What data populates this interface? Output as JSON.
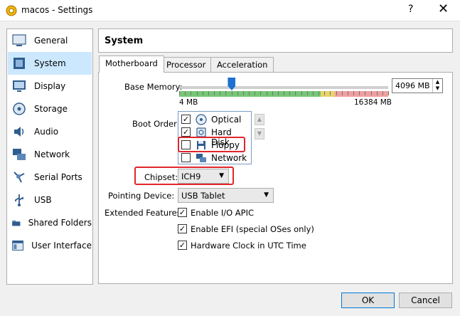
{
  "window": {
    "title": "macos - Settings",
    "help_label": "?",
    "close_label": "✕"
  },
  "sidebar": {
    "items": [
      {
        "label": "General",
        "icon": "general-icon"
      },
      {
        "label": "System",
        "icon": "system-icon",
        "selected": true
      },
      {
        "label": "Display",
        "icon": "display-icon"
      },
      {
        "label": "Storage",
        "icon": "storage-icon"
      },
      {
        "label": "Audio",
        "icon": "audio-icon"
      },
      {
        "label": "Network",
        "icon": "network-icon"
      },
      {
        "label": "Serial Ports",
        "icon": "serial-ports-icon"
      },
      {
        "label": "USB",
        "icon": "usb-icon"
      },
      {
        "label": "Shared Folders",
        "icon": "shared-folders-icon"
      },
      {
        "label": "User Interface",
        "icon": "user-interface-icon"
      }
    ]
  },
  "page": {
    "title": "System"
  },
  "tabs": [
    {
      "label": "Motherboard",
      "active": true
    },
    {
      "label": "Processor"
    },
    {
      "label": "Acceleration"
    }
  ],
  "motherboard": {
    "base_memory_label": "Base Memory:",
    "memory_min_label": "4 MB",
    "memory_max_label": "16384 MB",
    "memory_value": "4096 MB",
    "memory_mb": 4096,
    "memory_min_mb": 4,
    "memory_max_mb": 16384,
    "boot_order_label": "Boot Order:",
    "boot_items": [
      {
        "label": "Optical",
        "checked": true,
        "icon": "optical-disc-icon"
      },
      {
        "label": "Hard Disk",
        "checked": true,
        "icon": "hard-disk-icon"
      },
      {
        "label": "Floppy",
        "checked": false,
        "icon": "floppy-icon"
      },
      {
        "label": "Network",
        "checked": false,
        "icon": "network-boot-icon"
      }
    ],
    "chipset_label": "Chipset:",
    "chipset_value": "ICH9",
    "pointing_device_label": "Pointing Device:",
    "pointing_device_value": "USB Tablet",
    "extended_features_label": "Extended Features:",
    "features": [
      {
        "label": "Enable I/O APIC",
        "checked": true
      },
      {
        "label": "Enable EFI (special OSes only)",
        "checked": true
      },
      {
        "label": "Hardware Clock in UTC Time",
        "checked": true
      }
    ]
  },
  "buttons": {
    "ok": "OK",
    "cancel": "Cancel"
  },
  "colors": {
    "accent": "#1e6fd1",
    "selection": "#cce8ff",
    "highlight": "#e0262c",
    "memory_ok": "#76c776",
    "memory_warn": "#e8d36a",
    "memory_bad": "#f0a0a0"
  }
}
